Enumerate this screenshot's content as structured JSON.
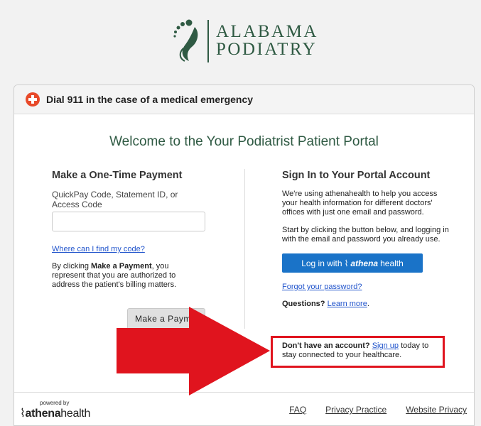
{
  "logo": {
    "line1": "ALABAMA",
    "line2": "PODIATRY"
  },
  "banner": {
    "text": "Dial 911 in the case of a medical emergency"
  },
  "welcome": "Welcome to the Your Podiatrist Patient Portal",
  "payment": {
    "heading": "Make a One-Time Payment",
    "field_label": "QuickPay Code, Statement ID, or Access Code",
    "field_value": "",
    "find_code_link": "Where can I find my code?",
    "auth_prefix": "By clicking ",
    "auth_bold": "Make a Payment",
    "auth_suffix": ", you represent that you are authorized to address the patient's billing matters.",
    "button_label": "Make a Payme"
  },
  "signin": {
    "heading": "Sign In to Your Portal Account",
    "intro": "We're using athenahealth to help you access your health information for different doctors' offices with just one email and password.",
    "start": "Start by clicking the button below, and logging in with the email and password you already use.",
    "login_prefix": "Log in with",
    "login_brand": "athena",
    "login_brand_suffix": "health",
    "forgot_link": "Forgot your password?",
    "questions_label": "Questions?",
    "learn_more_link": "Learn more",
    "questions_suffix": ".",
    "no_account_label": "Don't have an account?",
    "signup_link": "Sign up",
    "signup_suffix": " today to stay connected to your healthcare."
  },
  "footer": {
    "powered_by": "powered by",
    "brand_bold": "athena",
    "brand_rest": "health",
    "links": [
      "FAQ",
      "Privacy Practice",
      "Website Privacy"
    ]
  },
  "colors": {
    "brand_green": "#2f5a43",
    "button_blue": "#1a73c8",
    "arrow_red": "#e0141e",
    "alert_orange": "#e84a2a"
  },
  "icons": {
    "banner": "medical-cross-icon",
    "logo": "foot-logo-icon",
    "annotation": "arrow-right-icon"
  }
}
